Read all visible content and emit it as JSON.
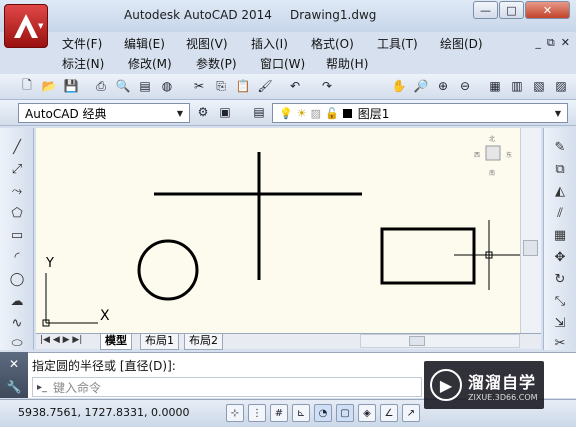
{
  "titlebar": {
    "app_title": "Autodesk AutoCAD 2014",
    "doc_title": "Drawing1.dwg",
    "minimize": "—",
    "maximize": "□",
    "close": "✕"
  },
  "menubar": {
    "row1": [
      "文件(F)",
      "编辑(E)",
      "视图(V)",
      "插入(I)",
      "格式(O)",
      "工具(T)",
      "绘图(D)"
    ],
    "row2": [
      "标注(N)",
      "修改(M)",
      "参数(P)",
      "窗口(W)",
      "帮助(H)"
    ],
    "doc_controls": [
      "_",
      "⧉",
      "✕"
    ]
  },
  "workspace": {
    "selected": "AutoCAD 经典"
  },
  "layer": {
    "current": "图层1",
    "color": "#000000"
  },
  "viewcube": {
    "north": "北",
    "south": "南",
    "east": "东",
    "west": "西"
  },
  "ucs": {
    "x_label": "X",
    "y_label": "Y"
  },
  "layout_tabs": [
    "模型",
    "布局1",
    "布局2"
  ],
  "command": {
    "history": "指定圆的半径或 [直径(D)]:",
    "placeholder": "键入命令"
  },
  "status": {
    "coords": "5938.7561, 1727.8331, 0.0000"
  },
  "watermark": {
    "title": "溜溜自学",
    "url": "ZIXUE.3D66.COM"
  },
  "colors": {
    "canvas": "#fdfbee",
    "ribbon_bg": "#d6e0ee",
    "app_button": "#c21a1a"
  },
  "icons": {
    "left_toolbar": [
      "line-icon",
      "construction-line-icon",
      "polyline-icon",
      "polygon-icon",
      "rectangle-icon",
      "arc-icon",
      "circle-icon",
      "revision-cloud-icon",
      "spline-icon",
      "ellipse-icon"
    ],
    "right_toolbar": [
      "erase-icon",
      "copy-icon",
      "mirror-icon",
      "offset-icon",
      "array-icon",
      "move-icon",
      "rotate-icon",
      "scale-icon",
      "stretch-icon",
      "trim-icon"
    ]
  }
}
